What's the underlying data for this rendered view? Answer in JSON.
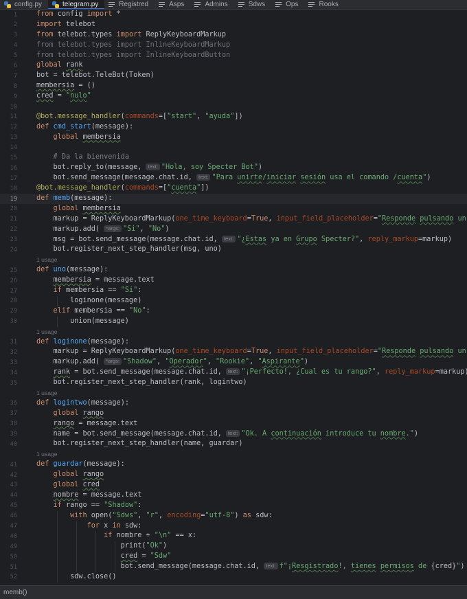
{
  "tabs": [
    {
      "label": "config.py",
      "icon": "python-file-icon",
      "active": false
    },
    {
      "label": "telegram.py",
      "icon": "python-file-icon",
      "active": true
    },
    {
      "label": "Registred",
      "icon": "text-file-icon",
      "active": false
    },
    {
      "label": "Asps",
      "icon": "text-file-icon",
      "active": false
    },
    {
      "label": "Admins",
      "icon": "text-file-icon",
      "active": false
    },
    {
      "label": "Sdws",
      "icon": "text-file-icon",
      "active": false
    },
    {
      "label": "Ops",
      "icon": "text-file-icon",
      "active": false
    },
    {
      "label": "Rooks",
      "icon": "text-file-icon",
      "active": false
    }
  ],
  "current_line": 19,
  "colors": {
    "keyword": "#cf8e6d",
    "string": "#6aab73",
    "decorator": "#b3ae60",
    "function": "#56a8f5",
    "parameter": "#aa4926",
    "comment": "#7a7e85"
  },
  "code": [
    {
      "n": "1",
      "indent": 0,
      "tokens": [
        [
          "kw",
          "from"
        ],
        [
          "",
          "config"
        ],
        [
          "kw",
          "import"
        ],
        [
          "",
          "*"
        ]
      ],
      "raw": "from config import *"
    },
    {
      "n": "2",
      "indent": 0,
      "raw": "import telebot",
      "tokens": [
        [
          "kw",
          "import"
        ],
        [
          "",
          "telebot"
        ]
      ]
    },
    {
      "n": "3",
      "indent": 0,
      "raw": "from telebot.types import ReplyKeyboardMarkup"
    },
    {
      "n": "4",
      "indent": 0,
      "raw": "from telebot.types import InlineKeyboardMarkup",
      "dim": true
    },
    {
      "n": "5",
      "indent": 0,
      "raw": "from telebot.types import InlineKeyboardButton",
      "dim": true
    },
    {
      "n": "6",
      "indent": 0,
      "raw": "global rank"
    },
    {
      "n": "7",
      "indent": 0,
      "raw": "bot = telebot.TeleBot(Token)"
    },
    {
      "n": "8",
      "indent": 0,
      "raw": "membersia = ()"
    },
    {
      "n": "9",
      "indent": 0,
      "raw": "cred = \"nulo\""
    },
    {
      "n": "10",
      "indent": 0,
      "raw": ""
    },
    {
      "n": "11",
      "indent": 0,
      "raw": "@bot.message_handler(commands=[\"start\", \"ayuda\"])"
    },
    {
      "n": "12",
      "indent": 0,
      "raw": "def cmd_start(message):"
    },
    {
      "n": "13",
      "indent": 1,
      "raw": "global membersia"
    },
    {
      "n": "14",
      "indent": 0,
      "raw": ""
    },
    {
      "n": "15",
      "indent": 1,
      "raw": "# Da la bienvenida"
    },
    {
      "n": "16",
      "indent": 1,
      "raw": "bot.reply_to(message, text: \"Hola, soy Specter Bot\")"
    },
    {
      "n": "17",
      "indent": 1,
      "raw": "bot.send_message(message.chat.id, text: \"Para unirte/iniciar sesión usa el comando /cuenta\")"
    },
    {
      "n": "18",
      "indent": 0,
      "raw": "@bot.message_handler(commands=[\"cuenta\"])"
    },
    {
      "n": "19",
      "indent": 0,
      "raw": "def memb(message):"
    },
    {
      "n": "20",
      "indent": 1,
      "raw": "global membersia"
    },
    {
      "n": "21",
      "indent": 1,
      "raw": "markup = ReplyKeyboardMarkup(one_time_keyboard=True, input_field_placeholder=\"Responde pulsando un botón\")"
    },
    {
      "n": "22",
      "indent": 1,
      "raw": "markup.add( *args: \"Si\", \"No\")"
    },
    {
      "n": "23",
      "indent": 1,
      "raw": "msg = bot.send_message(message.chat.id, text: \"¿Estas ya en Grupo Specter?\", reply_markup=markup)"
    },
    {
      "n": "24",
      "indent": 1,
      "raw": "bot.register_next_step_handler(msg, uno)"
    },
    {
      "n": "",
      "usage": "1 usage"
    },
    {
      "n": "25",
      "indent": 0,
      "raw": "def uno(message):"
    },
    {
      "n": "26",
      "indent": 1,
      "raw": "membersia = message.text"
    },
    {
      "n": "27",
      "indent": 1,
      "raw": "if membersia == \"Si\":"
    },
    {
      "n": "28",
      "indent": 2,
      "raw": "loginone(message)"
    },
    {
      "n": "29",
      "indent": 1,
      "raw": "elif membersia == \"No\":"
    },
    {
      "n": "30",
      "indent": 2,
      "raw": "union(message)"
    },
    {
      "n": "",
      "usage": "1 usage"
    },
    {
      "n": "31",
      "indent": 0,
      "raw": "def loginone(message):"
    },
    {
      "n": "32",
      "indent": 1,
      "raw": "markup = ReplyKeyboardMarkup(one_time_keyboard=True, input_field_placeholder=\"Responde pulsando un botón\")"
    },
    {
      "n": "33",
      "indent": 1,
      "raw": "markup.add( *args: \"Shadow\", \"Operador\", \"Rookie\", \"Aspirante\")"
    },
    {
      "n": "34",
      "indent": 1,
      "raw": "rank = bot.send_message(message.chat.id, text: \"¡Perfecto!, ¿Cual es tu rango?\", reply_markup=markup)"
    },
    {
      "n": "35",
      "indent": 1,
      "raw": "bot.register_next_step_handler(rank, logintwo)"
    },
    {
      "n": "",
      "usage": "1 usage"
    },
    {
      "n": "36",
      "indent": 0,
      "raw": "def logintwo(message):"
    },
    {
      "n": "37",
      "indent": 1,
      "raw": "global rango"
    },
    {
      "n": "38",
      "indent": 1,
      "raw": "rango = message.text"
    },
    {
      "n": "39",
      "indent": 1,
      "raw": "name = bot.send_message(message.chat.id, text: \"Ok. A continuación introduce tu nombre.\")"
    },
    {
      "n": "40",
      "indent": 1,
      "raw": "bot.register_next_step_handler(name, guardar)"
    },
    {
      "n": "",
      "usage": "1 usage"
    },
    {
      "n": "41",
      "indent": 0,
      "raw": "def guardar(message):"
    },
    {
      "n": "42",
      "indent": 1,
      "raw": "global rango"
    },
    {
      "n": "43",
      "indent": 1,
      "raw": "global cred"
    },
    {
      "n": "44",
      "indent": 1,
      "raw": "nombre = message.text"
    },
    {
      "n": "45",
      "indent": 1,
      "raw": "if rango == \"Shadow\":"
    },
    {
      "n": "46",
      "indent": 2,
      "raw": "with open(\"Sdws\", \"r\", encoding=\"utf-8\") as sdw:"
    },
    {
      "n": "47",
      "indent": 3,
      "raw": "for x in sdw:"
    },
    {
      "n": "48",
      "indent": 4,
      "raw": "if nombre + \"\\n\" == x:"
    },
    {
      "n": "49",
      "indent": 5,
      "raw": "print(\"Ok\")"
    },
    {
      "n": "50",
      "indent": 5,
      "raw": "cred = \"Sdw\""
    },
    {
      "n": "51",
      "indent": 5,
      "raw": "bot.send_message(message.chat.id, text: f\"¡Resgistrado!, tienes permisos de {cred}\")"
    },
    {
      "n": "52",
      "indent": 2,
      "raw": "sdw.close()"
    }
  ],
  "status": {
    "breadcrumb": "memb()"
  }
}
